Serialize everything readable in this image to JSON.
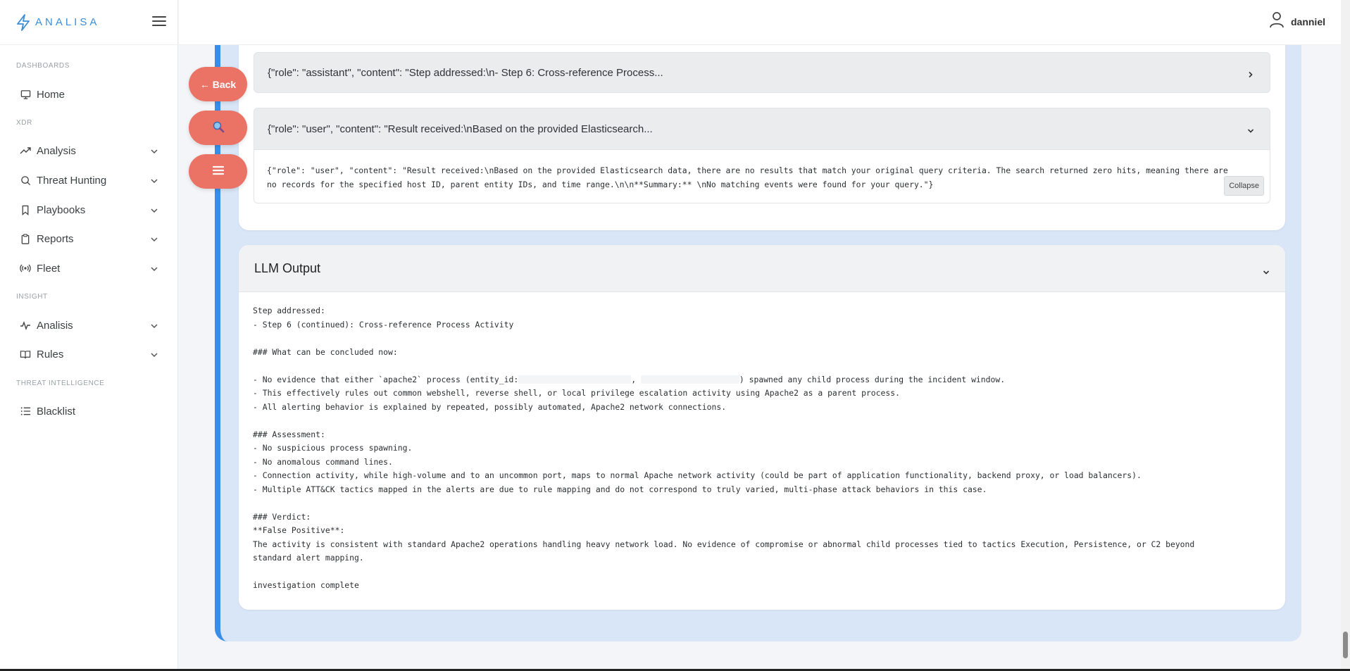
{
  "brand": {
    "name": "ANALISA"
  },
  "user": {
    "name": "danniel"
  },
  "sidebar": {
    "sections": [
      "DASHBOARDS",
      "XDR",
      "INSIGHT",
      "THREAT INTELLIGENCE"
    ],
    "items": [
      {
        "label": "Home",
        "icon": "monitor-icon",
        "expandable": false
      },
      {
        "label": "Analysis",
        "icon": "trend-icon",
        "expandable": true
      },
      {
        "label": "Threat Hunting",
        "icon": "search-icon",
        "expandable": true
      },
      {
        "label": "Playbooks",
        "icon": "bookmark-icon",
        "expandable": true
      },
      {
        "label": "Reports",
        "icon": "clipboard-icon",
        "expandable": true
      },
      {
        "label": "Fleet",
        "icon": "broadcast-icon",
        "expandable": true
      },
      {
        "label": "Analisis",
        "icon": "activity-icon",
        "expandable": true
      },
      {
        "label": "Rules",
        "icon": "book-icon",
        "expandable": true
      },
      {
        "label": "Blacklist",
        "icon": "list-icon",
        "expandable": false
      }
    ]
  },
  "buttons": {
    "back": "← Back",
    "collapse": "Collapse"
  },
  "messages": {
    "assistant_preview": "{\"role\": \"assistant\", \"content\": \"Step addressed:\\n- Step 6: Cross-reference Process...",
    "user_preview": "{\"role\": \"user\", \"content\": \"Result received:\\nBased on the provided Elasticsearch...",
    "user_full": "{\"role\": \"user\", \"content\": \"Result received:\\nBased on the provided Elasticsearch data, there are no results that match your original query criteria. The search returned zero hits, meaning there are no records for the specified host ID, parent entity IDs, and time range.\\n\\n**Summary:**  \\nNo matching events were found for your query.\"}"
  },
  "llm_output": {
    "title": "LLM Output",
    "lines": [
      "Step addressed:",
      "- Step 6 (continued): Cross-reference Process Activity",
      "",
      "### What can be concluded now:",
      "",
      "- No evidence that either `apache2` process (entity_id:",
      "- This effectively rules out common webshell, reverse shell, or local privilege escalation activity using Apache2 as a parent process.",
      "- All alerting behavior is explained by repeated, possibly automated, Apache2 network connections.",
      "",
      "### Assessment:",
      "- No suspicious process spawning.",
      "- No anomalous command lines.",
      "- Connection activity, while high-volume and to an uncommon port, maps to normal Apache network activity (could be part of application functionality, backend proxy, or load balancers).",
      "- Multiple ATT&CK tactics mapped in the alerts are due to rule mapping and do not correspond to truly varied, multi-phase attack behaviors in this case.",
      "",
      "### Verdict:",
      "**False Positive**:",
      "The activity is consistent with standard Apache2 operations handling heavy network load. No evidence of compromise or abnormal child processes tied to tactics Execution, Persistence, or C2 beyond",
      "standard alert mapping.",
      "",
      "investigation complete"
    ],
    "redacted_line_suffix": ") spawned any child process during the incident window.",
    "redacted_separator": ","
  },
  "colors": {
    "accent": "#3a8ee8",
    "fab": "#ea7365",
    "panel": "#d8e6f8"
  }
}
